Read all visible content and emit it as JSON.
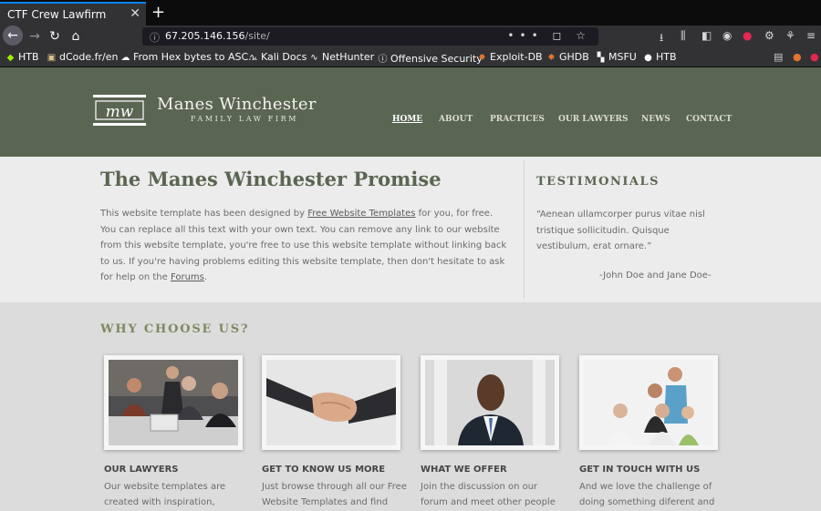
{
  "browser": {
    "tab_title": "CTF Crew Lawfirm",
    "tab_close": "✕",
    "new_tab": "+",
    "url_host": "67.205.146.156",
    "url_path": "/site/",
    "url_actions": "••• ◻ ☆",
    "bookmarks": [
      {
        "label": "HTB",
        "icon": "cube-icon",
        "color": "#9fef00"
      },
      {
        "label": "dCode.fr/en",
        "icon": "dcode-icon",
        "color": "#d9c38a"
      },
      {
        "label": "From Hex bytes to ASC...",
        "icon": "chef-icon",
        "color": "#dddddd"
      },
      {
        "label": "Kali Docs",
        "icon": "kali-dragon-icon",
        "color": "#dddddd"
      },
      {
        "label": "NetHunter",
        "icon": "kali-dragon-icon",
        "color": "#dddddd"
      },
      {
        "label": "Offensive Security",
        "icon": "offsec-icon",
        "color": "#dddddd"
      },
      {
        "label": "Exploit-DB",
        "icon": "exploitdb-icon",
        "color": "#e0762f"
      },
      {
        "label": "GHDB",
        "icon": "exploitdb-icon",
        "color": "#e0762f"
      },
      {
        "label": "MSFU",
        "icon": "msfu-icon",
        "color": "#dddddd"
      },
      {
        "label": "HTB",
        "icon": "github-icon",
        "color": "#dddddd"
      }
    ]
  },
  "site": {
    "logo_mark": "mw",
    "logo_name": "Manes Winchester",
    "logo_sub": "FAMILY LAW FIRM",
    "nav": [
      "HOME",
      "ABOUT",
      "PRACTICES",
      "OUR LAWYERS",
      "NEWS",
      "CONTACT"
    ],
    "active_nav": "HOME",
    "colors": {
      "header": "#5a6552",
      "accent": "#7d8a62",
      "band_light": "#ececec",
      "band_dark": "#dcdcdc"
    }
  },
  "promise": {
    "title": "The Manes Winchester Promise",
    "p1": "This website template has been designed by ",
    "link1": "Free Website Templates",
    "p2": " for you, for free. You can replace all this text with your own text. You can remove any link to our website from this website template, you're free to use this website template without linking back to us. If you're having problems editing this website template, then don't hesitate to ask for help on the ",
    "link2": "Forums",
    "p3": "."
  },
  "testimonials": {
    "title": "TESTIMONIALS",
    "quote": "“Aenean ullamcorper purus vitae nisl tristique sollicitudin. Quisque vestibulum, erat ornare.”",
    "author": "-John Doe and Jane Doe-"
  },
  "why": {
    "title": "WHY CHOOSE US?",
    "cards": [
      {
        "title": "OUR LAWYERS",
        "text": "Our website templates are created with inspiration, checked"
      },
      {
        "title": "GET TO KNOW US MORE",
        "text": "Just browse through all our Free Website Templates and find what"
      },
      {
        "title": "WHAT WE OFFER",
        "text": "Join the discussion on our forum and meet other people in the"
      },
      {
        "title": "GET IN TOUCH WITH US",
        "text": "And we love the challenge of doing something diferent and"
      }
    ]
  }
}
